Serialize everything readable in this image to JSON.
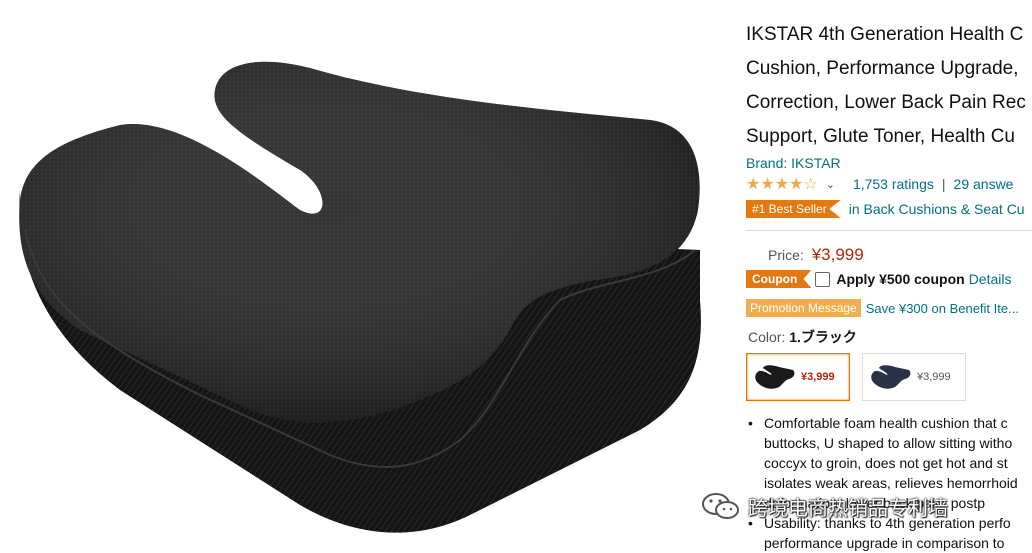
{
  "product": {
    "title_lines": [
      "IKSTAR 4th Generation Health C",
      "Cushion, Performance Upgrade,",
      "Correction, Lower Back Pain Rec",
      "Support, Glute Toner, Health Cu"
    ],
    "brand": "Brand: IKSTAR",
    "stars": "★★★★☆",
    "rating_count": "1,753 ratings",
    "separator": "|",
    "answers": "29 answe",
    "bestseller_badge": "#1 Best Seller",
    "bestseller_category": "in Back Cushions & Seat Cu",
    "price_label": "Price:",
    "price": "¥3,999",
    "coupon_badge": "Coupon",
    "coupon_text": "Apply ¥500 coupon",
    "coupon_details": "Details",
    "promo_badge": "Promotion Message",
    "promo_text": "Save ¥300 on Benefit Ite...",
    "color_label": "Color:",
    "color_value": "1.ブラック",
    "swatches": [
      {
        "price": "¥3,999",
        "selected": true,
        "color": "#1a1a1a"
      },
      {
        "price": "¥3,999",
        "selected": false,
        "color": "#2b3247"
      }
    ],
    "bullets": [
      [
        "Comfortable foam health cushion that c",
        "buttocks, U shaped to allow sitting witho",
        "coccyx to groin, does not get hot and st",
        "isolates weak areas, relieves hemorrhoid",
        "deformation, lower back pain, postp"
      ],
      [
        "Usability: thanks to 4th generation perfo",
        "performance upgrade in comparison to"
      ]
    ]
  },
  "watermark": {
    "text": "跨境电商热销品专利墙",
    "icon": "wechat-icon"
  },
  "colors": {
    "link": "#007185",
    "price": "#b12704",
    "badge": "#e47911",
    "promo": "#f0ad4e"
  }
}
